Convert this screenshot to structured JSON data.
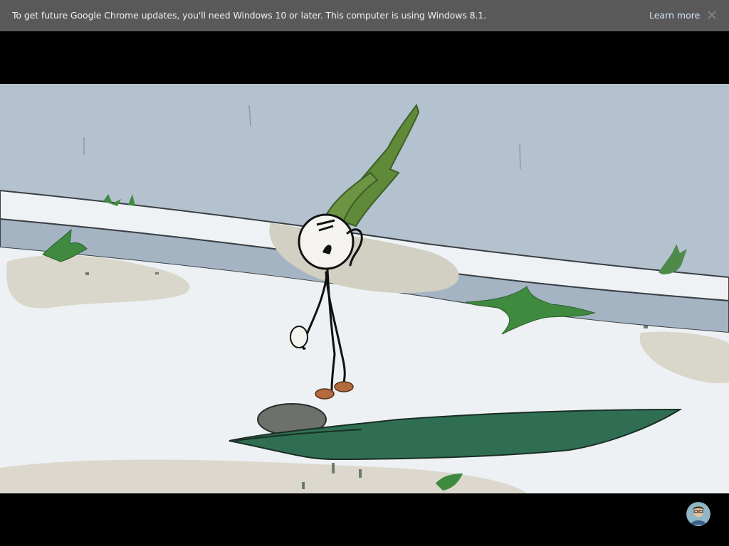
{
  "infobar": {
    "message": "To get future Google Chrome updates, you'll need Windows 10 or later. This computer is using Windows 8.1.",
    "link_label": "Learn more",
    "close_icon": "close-icon"
  },
  "game": {
    "scene": "stickman-standing-on-snow",
    "colors": {
      "sky": "#b3c2ce",
      "snow": "#edf1f4",
      "dirt": "#d6d3c8",
      "plant": "#3f8a3f",
      "leaf": "#2f6e52",
      "rock": "#6e706c"
    }
  },
  "avatar": {
    "icon": "user-avatar-icon"
  }
}
